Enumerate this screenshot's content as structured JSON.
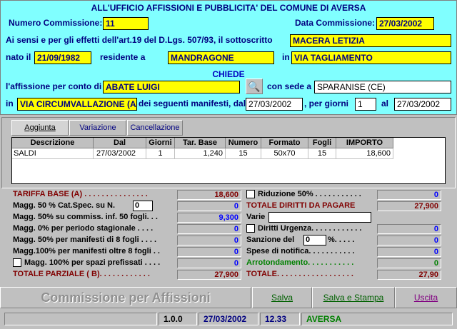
{
  "header": {
    "title": "ALL'UFFICIO AFFISSIONI E PUBBLICITA' DEL COMUNE DI AVERSA",
    "numero_label": "Numero Commissione:",
    "numero_value": "11",
    "data_label": "Data Commissione:",
    "data_value": "27/03/2002",
    "sensi_label": "Ai sensi e per gli effetti dell'art.19 del D.Lgs. 507/93, il sottoscritto",
    "sottoscritto_value": "MACERA LETIZIA",
    "nato_label": "nato il",
    "nato_value": "21/09/1982",
    "residente_label": "residente a",
    "residente_value": "MANDRAGONE",
    "in_label": "in",
    "via_value": "VIA TAGLIAMENTO",
    "chiede": "CHIEDE",
    "affissione_label": "l'affissione per conto di",
    "conto_value": "ABATE LUIGI",
    "sede_label": "con sede a",
    "sede_value": "SPARANISE (CE)",
    "in2_label": "in",
    "via2_value": "VIA CIRCUMVALLAZIONE (A",
    "manifesti_label": "dei seguenti manifesti, dal",
    "dal_value": "27/03/2002",
    "giorni_label": ", per giorni",
    "giorni_value": "1",
    "al_label": "al",
    "al_value": "27/03/2002"
  },
  "tabs": [
    {
      "label": "Aggiunta"
    },
    {
      "label": "Variazione"
    },
    {
      "label": "Cancellazione"
    }
  ],
  "grid": {
    "headers": [
      "Descrizione",
      "Dal",
      "Giorni",
      "Tar. Base",
      "Numero",
      "Formato",
      "Fogli",
      "IMPORTO"
    ],
    "rows": [
      [
        "SALDI",
        "27/03/2002",
        "1",
        "1,240",
        "15",
        "50x70",
        "15",
        "18,600"
      ]
    ]
  },
  "calc_left": {
    "tariffa_label": "TARIFFA BASE (A) . . . . . . . . . . . . . . .",
    "tariffa_value": "18,600",
    "magg1_label": "Magg. 50 % Cat.Spec. su N.",
    "magg1_value": "0",
    "magg2_label": "Magg.  50% su commiss. inf.  50 fogli. . .",
    "magg2_value": "9,300",
    "magg3_label": "Magg.    0%  per periodo stagionale . . . .",
    "magg3_value": "0",
    "magg4_label": "Magg.  50% per manifesti di 8 fogli . . . .",
    "magg4_value": "0",
    "magg5_label": "Magg.100% per manifesti oltre 8 fogli . .",
    "magg5_value": "0",
    "magg6_label": "Magg. 100% per spazi prefissati . . . .",
    "magg6_value": "0",
    "totale_label": "TOTALE PARZIALE ( B). . . . . . . . . . . .",
    "totale_value": "27,900"
  },
  "calc_right": {
    "riduzione_label": "Riduzione 50% . . . . . . . . . . .",
    "riduzione_value": "0",
    "diritti_label": "TOTALE DIRITTI DA PAGARE",
    "diritti_value": "27,900",
    "varie_label": "Varie",
    "urgenza_label": "Diritti Urgenza. . . . . . . . . . . .",
    "urgenza_value": "0",
    "sanzione_label": "Sanzione del",
    "sanzione_input": "0",
    "sanzione_pct": "%. . . . .",
    "sanzione_value": "0",
    "spese_label": "Spese di notifica. . . . . . . . . . .",
    "spese_value": "0",
    "arrot_label": "Arrotondamento. . . . . . . . . . .",
    "arrot_value": "0",
    "totale_label": "TOTALE. . . . . . . . . . . . . . . . . .",
    "totale_value": "27,90"
  },
  "buttons": {
    "title": "Commissione per Affissioni",
    "salva": "Salva",
    "salva_stampa": "Salva e Stampa",
    "uscita": "Uscita"
  },
  "status": {
    "version": "1.0.0",
    "date": "27/03/2002",
    "time": "12.33",
    "city": "AVERSA"
  }
}
